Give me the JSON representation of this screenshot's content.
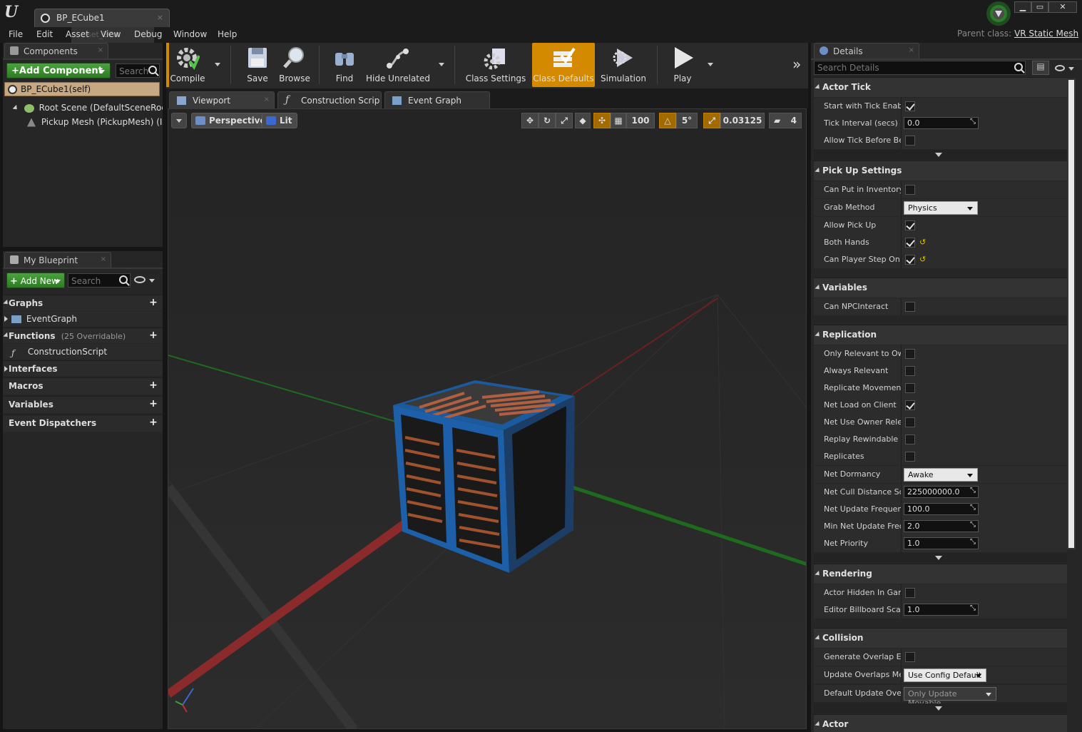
{
  "window": {
    "tab_title": "BP_ECube1",
    "ghost_label": "set_ECu",
    "parent_class_label": "Parent class:",
    "parent_class_value": "VR Static Mesh"
  },
  "menu": [
    "File",
    "Edit",
    "Asset",
    "View",
    "Debug",
    "Window",
    "Help"
  ],
  "components": {
    "tab": "Components",
    "add_button": "+Add Component",
    "search_placeholder": "Search",
    "self_item": "BP_ECube1(self)",
    "items": [
      "Root Scene (DefaultSceneRoot) (I",
      "Pickup Mesh (PickupMesh) (Inh"
    ]
  },
  "my_blueprint": {
    "tab": "My Blueprint",
    "add_button": "Add New",
    "search_placeholder": "Search",
    "sections": {
      "graphs": "Graphs",
      "event_graph": "EventGraph",
      "functions": "Functions",
      "functions_note": "(25 Overridable)",
      "construction": "ConstructionScript",
      "interfaces": "Interfaces",
      "macros": "Macros",
      "variables": "Variables",
      "dispatchers": "Event Dispatchers"
    }
  },
  "toolbar": {
    "compile": "Compile",
    "save": "Save",
    "browse": "Browse",
    "find": "Find",
    "hide_unrelated": "Hide Unrelated",
    "class_settings": "Class Settings",
    "class_defaults": "Class Defaults",
    "simulation": "Simulation",
    "play": "Play"
  },
  "editor_tabs": [
    "Viewport",
    "Construction Scrip",
    "Event Graph"
  ],
  "viewport": {
    "perspective": "Perspective",
    "lit": "Lit",
    "grid_snap": "100",
    "rot_snap": "5°",
    "scale_snap": "0.03125",
    "cam_speed": "4"
  },
  "details": {
    "tab": "Details",
    "search_placeholder": "Search Details",
    "categories": {
      "actor_tick": "Actor Tick",
      "pickup": "Pick Up Settings",
      "variables": "Variables",
      "replication": "Replication",
      "rendering": "Rendering",
      "collision": "Collision",
      "actor": "Actor"
    },
    "props": {
      "start_tick": "Start with Tick Enable",
      "tick_interval": "Tick Interval (secs)",
      "tick_interval_val": "0.0",
      "allow_tick": "Allow Tick Before Beg",
      "can_put": "Can Put in Inventory",
      "grab_method": "Grab Method",
      "grab_method_val": "Physics",
      "allow_pickup": "Allow Pick Up",
      "both_hands": "Both Hands",
      "can_step": "Can Player Step On",
      "can_npc": "Can NPCInteract",
      "only_relevant": "Only Relevant to Own",
      "always_relevant": "Always Relevant",
      "replicate_movement": "Replicate Movement",
      "net_load": "Net Load on Client",
      "net_use_owner": "Net Use Owner Releva",
      "replay_rewind": "Replay Rewindable",
      "replicates": "Replicates",
      "net_dormancy": "Net Dormancy",
      "net_dormancy_val": "Awake",
      "net_cull": "Net Cull Distance Squ",
      "net_cull_val": "225000000.0",
      "net_update": "Net Update Frequency",
      "net_update_val": "100.0",
      "min_net_update": "Min Net Update Frequ",
      "min_net_update_val": "2.0",
      "net_priority": "Net Priority",
      "net_priority_val": "1.0",
      "hidden_in_game": "Actor Hidden In Game",
      "billboard_scale": "Editor Billboard Scale",
      "billboard_scale_val": "1.0",
      "gen_overlap": "Generate Overlap Eve",
      "update_overlaps": "Update Overlaps Meth",
      "update_overlaps_val": "Use Config Default",
      "default_update": "Default Update Overla",
      "default_update_val": "Only Update Movable"
    }
  },
  "colors": {
    "accent_orange": "#d48a00",
    "green_button": "#3b8f31",
    "axis_red": "#8a2a2a",
    "axis_green": "#1e6b1e"
  }
}
